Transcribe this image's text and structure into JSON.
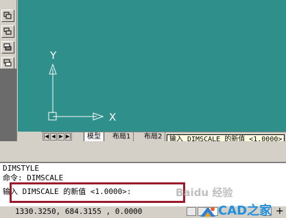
{
  "canvas": {
    "background": "#2f8f8a",
    "ucs": {
      "y_label": "Y",
      "x_label": "X"
    }
  },
  "layout_tabs": {
    "nav_first": "|◀",
    "nav_prev": "◀",
    "nav_next": "▶",
    "nav_last": "▶|",
    "tabs": [
      {
        "label": "模型",
        "active": true
      },
      {
        "label": "布局1",
        "active": false
      },
      {
        "label": "布局2",
        "active": false
      }
    ]
  },
  "tooltip": {
    "text": "输入 DIMSCALE 的新值 <1.0000>:"
  },
  "command_window": {
    "lines": [
      "DIMSTYLE",
      "命令: DIMSCALE",
      "输入 DIMSCALE 的新值 <1.0000>:"
    ],
    "highlight_color": "#9b1b2a"
  },
  "status_bar": {
    "coordinates": "1330.3250, 684.3155 , 0.0000"
  },
  "watermark": {
    "text": "Baidu 经验",
    "logo_text": "CAD之家"
  },
  "icons": {
    "toolbar": [
      "copy-icon",
      "block-icon",
      "layer-icon",
      "stack-icon"
    ]
  }
}
